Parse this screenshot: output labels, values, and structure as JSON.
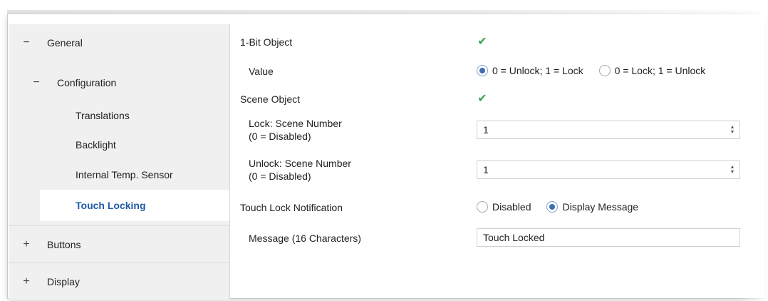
{
  "sidebar": {
    "items": [
      {
        "sign": "−",
        "label": "General"
      },
      {
        "sign": "−",
        "label": "Configuration"
      },
      {
        "label": "Translations"
      },
      {
        "label": "Backlight"
      },
      {
        "label": "Internal Temp. Sensor"
      },
      {
        "label": "Touch Locking"
      },
      {
        "sign": "+",
        "label": "Buttons"
      },
      {
        "sign": "+",
        "label": "Display"
      }
    ]
  },
  "form": {
    "one_bit_object": {
      "label": "1-Bit Object",
      "checked": true
    },
    "value": {
      "label": "Value",
      "options": [
        "0 = Unlock; 1 = Lock",
        "0 = Lock; 1 = Unlock"
      ],
      "selected": "0 = Unlock; 1 = Lock"
    },
    "scene_object": {
      "label": "Scene Object",
      "checked": true
    },
    "lock_scene": {
      "label_line1": "Lock: Scene Number",
      "label_line2": "(0 = Disabled)",
      "value": "1"
    },
    "unlock_scene": {
      "label_line1": "Unlock: Scene Number",
      "label_line2": "(0 = Disabled)",
      "value": "1"
    },
    "notification": {
      "label": "Touch Lock Notification",
      "options": [
        "Disabled",
        "Display Message"
      ],
      "selected": "Display Message"
    },
    "message": {
      "label": "Message (16 Characters)",
      "value": "Touch Locked"
    }
  },
  "icons": {
    "check": "checkmark-icon",
    "spin_up": "spin-up-icon",
    "spin_down": "spin-down-icon"
  },
  "colors": {
    "selected_text": "#1f5aa6",
    "check": "#3aa24c",
    "radio_dot": "#3e6fb0"
  }
}
